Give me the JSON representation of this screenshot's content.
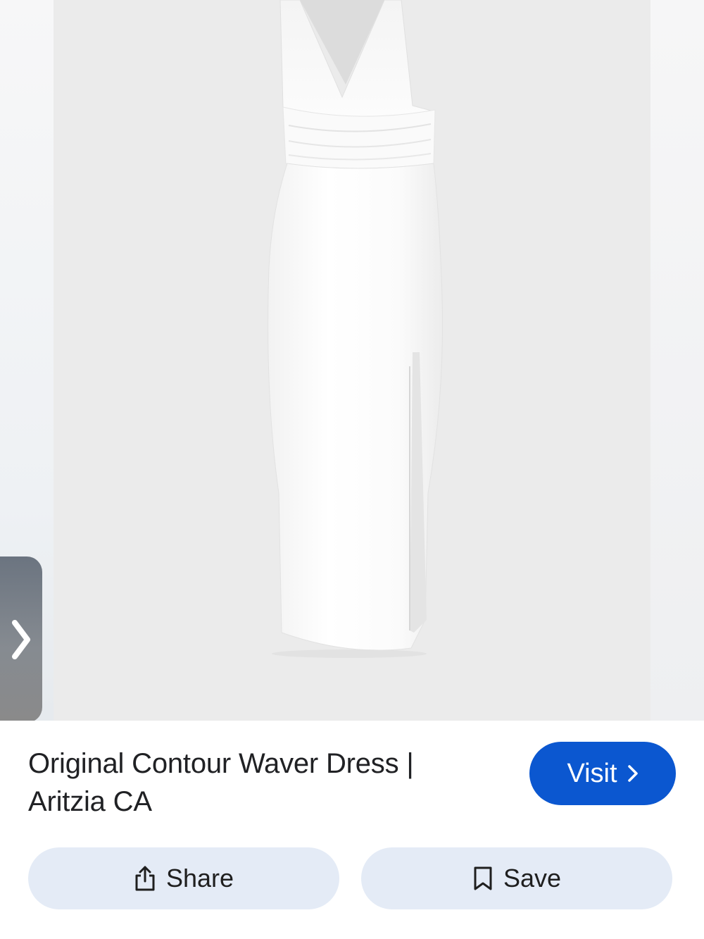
{
  "product": {
    "title": "Original Contour Waver Dress | Aritzia CA",
    "image_alt": "White halter midi dress with side slit"
  },
  "actions": {
    "visit_label": "Visit",
    "share_label": "Share",
    "save_label": "Save"
  },
  "icons": {
    "side_tab": "chevron-right-icon",
    "visit": "chevron-right-icon",
    "share": "share-icon",
    "save": "bookmark-icon"
  },
  "colors": {
    "accent": "#0b57d0",
    "action_button_bg": "#e4ebf6",
    "text": "#202124",
    "photo_bg": "#ebebeb"
  }
}
